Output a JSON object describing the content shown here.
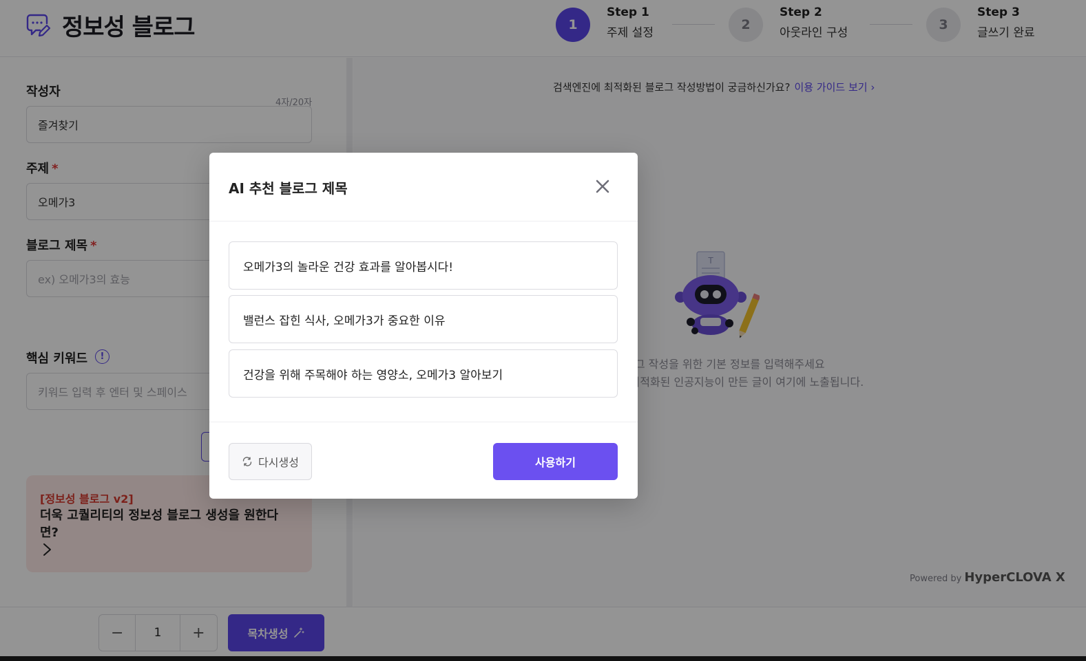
{
  "app": {
    "title": "정보성 블로그"
  },
  "steps": [
    {
      "number": "1",
      "title": "Step 1",
      "label": "주제 설정",
      "active": true
    },
    {
      "number": "2",
      "title": "Step 2",
      "label": "아웃라인 구성",
      "active": false
    },
    {
      "number": "3",
      "title": "Step 3",
      "label": "글쓰기 완료",
      "active": false
    }
  ],
  "form": {
    "author": {
      "label": "작성자",
      "value": "즐겨찾기",
      "counter": "4자/20자"
    },
    "topic": {
      "label": "주제",
      "required_mark": "*",
      "value": "오메가3"
    },
    "blog_title": {
      "label": "블로그 제목",
      "required_mark": "*",
      "placeholder": "ex) 오메가3의 효능"
    },
    "keywords": {
      "label": "핵심 키워드",
      "info_icon": "!",
      "placeholder": "키워드 입력 후 엔터 및 스페이스"
    }
  },
  "promo": {
    "tag": "[정보성 블로그 v2]",
    "text": "더욱 고퀄리티의 정보성 블로그 생성을 원한다면?",
    "icon": "chevron-right-icon"
  },
  "right_panel": {
    "guide_text": "검색엔진에 최적화된 블로그 작성방법이 궁금하신가요?",
    "guide_link": "이용 가이드 보기 ›",
    "empty_line1": "블로그 작성을 위한 기본 정보를 입력해주세요",
    "empty_line2": "검색엔진에 최적화된 인공지능이 만든 글이 여기에 노출됩니다.",
    "powered_by": "Powered by",
    "powered_brand": "HyperCLOVA X"
  },
  "bottom_bar": {
    "stepper": {
      "minus": "−",
      "value": "1",
      "plus": "+"
    },
    "toc_button": "목차생성"
  },
  "modal": {
    "title": "AI 추천 블로그 제목",
    "suggestions": [
      "오메가3의 놀라운 건강 효과를 알아봅시다!",
      "밸런스 잡힌 식사, 오메가3가 중요한 이유",
      "건강을 위해 주목해야 하는 영양소, 오메가3 알아보기"
    ],
    "regenerate_button": "다시생성",
    "use_button": "사용하기"
  },
  "colors": {
    "accent": "#5b46e8",
    "primary_button": "#6b50f0",
    "required": "#e03a3a",
    "promo_background": "#fde9e7",
    "promo_tag": "#d63a2f",
    "overlay": "rgba(0,0,0,0.42)"
  }
}
